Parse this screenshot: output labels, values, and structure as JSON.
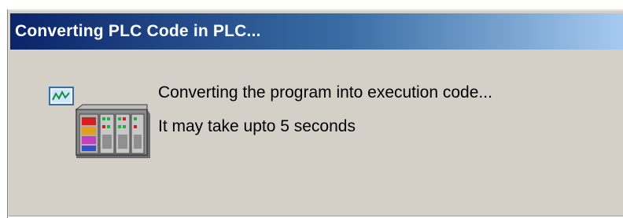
{
  "window": {
    "title": "Converting PLC Code in PLC..."
  },
  "message": {
    "line1": "Converting the program into execution code...",
    "line2": "It may take upto 5 seconds"
  },
  "icons": {
    "main": "plc-device-icon"
  },
  "colors": {
    "titlebar_start": "#0a246a",
    "titlebar_end": "#a6caf0",
    "dialog_bg": "#d4d0c8"
  }
}
